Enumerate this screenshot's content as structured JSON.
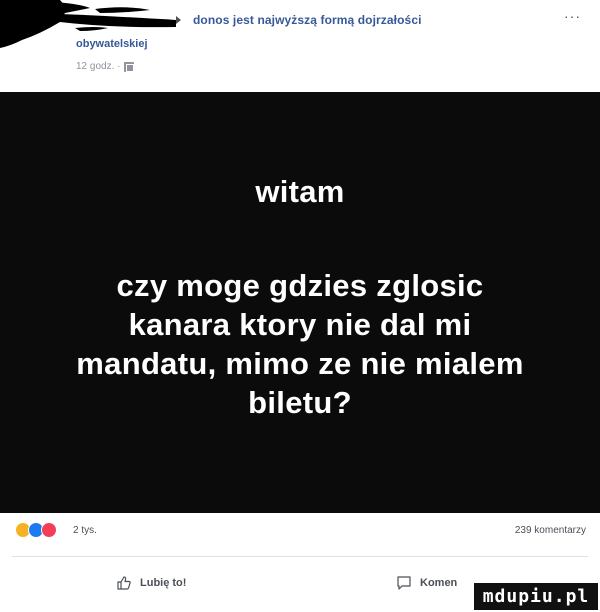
{
  "post": {
    "title": "donos jest najwyższą formą dojrzałości",
    "subtitle": "obywatelskiej",
    "meta_time": "12 godz. ·",
    "more_label": "···"
  },
  "image_text": {
    "greeting": "witam",
    "lines": [
      "czy moge gdzies zglosic",
      "kanara ktory nie dal mi",
      "mandatu, mimo ze nie mialem",
      "biletu?"
    ]
  },
  "reactions": {
    "count": "2 tys.",
    "comments": "239 komentarzy"
  },
  "actions": {
    "like_label": "Lubię to!",
    "comment_label": "Komen"
  },
  "watermark": "mdupiu.pl",
  "colors": {
    "link": "#365899",
    "meta": "#90949c",
    "image_bg": "#0b0b0b"
  }
}
